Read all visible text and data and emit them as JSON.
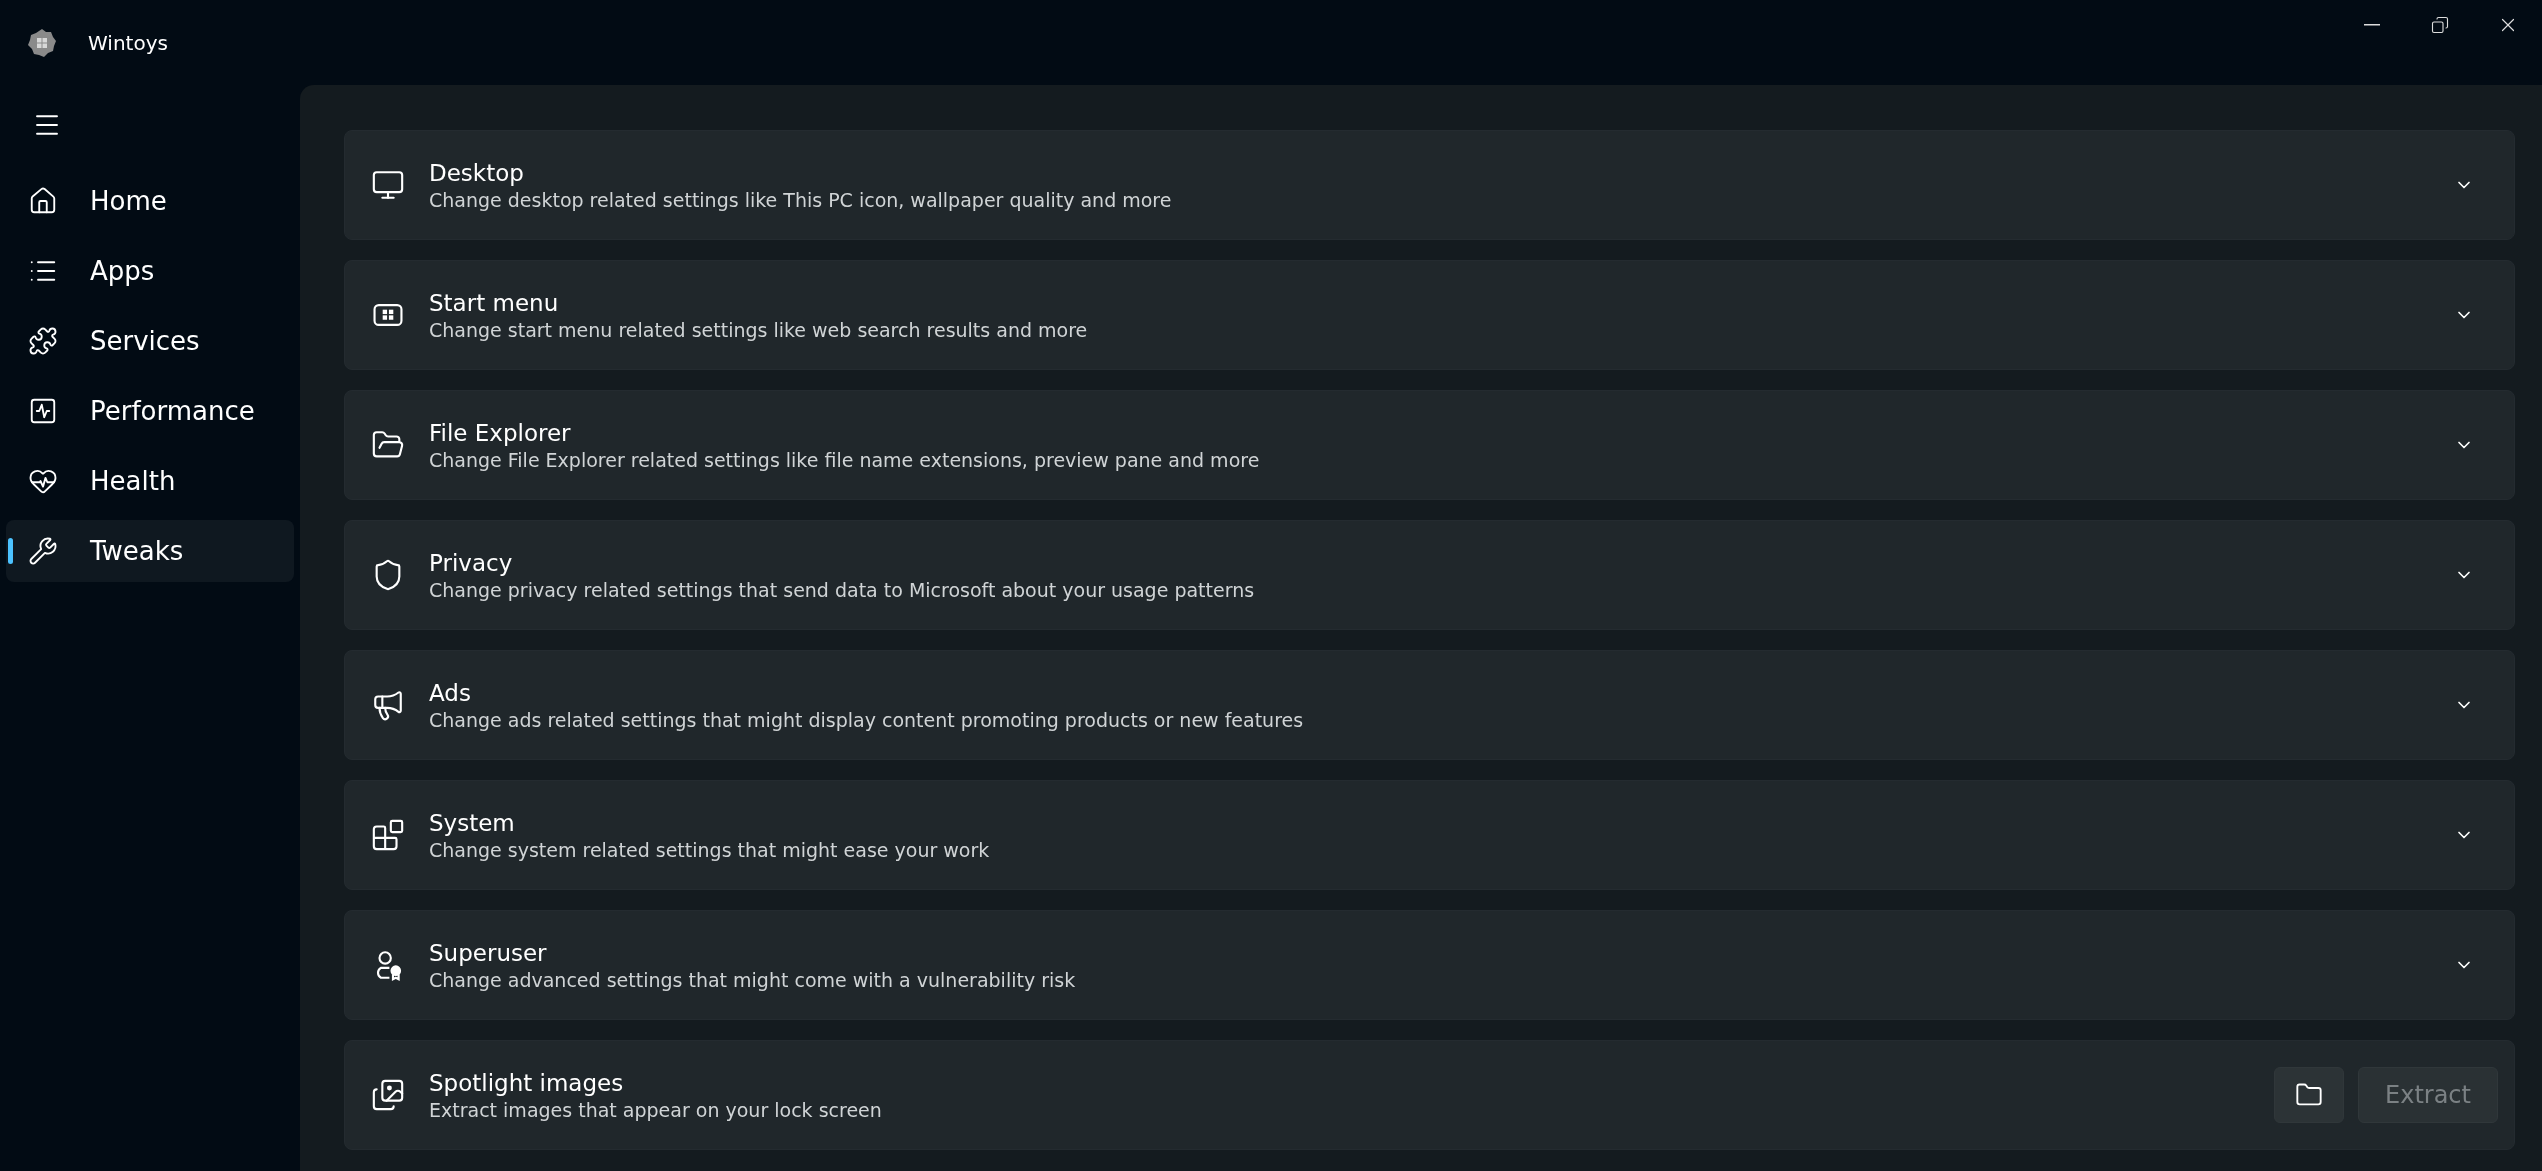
{
  "window": {
    "title": "Wintoys"
  },
  "sidebar": {
    "items": [
      {
        "label": "Home",
        "selected": false
      },
      {
        "label": "Apps",
        "selected": false
      },
      {
        "label": "Services",
        "selected": false
      },
      {
        "label": "Performance",
        "selected": false
      },
      {
        "label": "Health",
        "selected": false
      },
      {
        "label": "Tweaks",
        "selected": true
      }
    ]
  },
  "cards": [
    {
      "kind": "expander",
      "title": "Desktop",
      "description": "Change desktop related settings like This PC icon, wallpaper quality and more",
      "expanded": false
    },
    {
      "kind": "expander",
      "title": "Start menu",
      "description": "Change start menu related settings like web search results and more",
      "expanded": false
    },
    {
      "kind": "expander",
      "title": "File Explorer",
      "description": "Change File Explorer related settings like file name extensions, preview pane and more",
      "expanded": false
    },
    {
      "kind": "expander",
      "title": "Privacy",
      "description": "Change privacy related settings that send data to Microsoft about your usage patterns",
      "expanded": false
    },
    {
      "kind": "expander",
      "title": "Ads",
      "description": "Change ads related settings that might display content promoting products or new features",
      "expanded": false
    },
    {
      "kind": "expander",
      "title": "System",
      "description": "Change system related settings that might ease your work",
      "expanded": false
    },
    {
      "kind": "expander",
      "title": "Superuser",
      "description": "Change advanced settings that might come with a vulnerability risk",
      "expanded": false
    },
    {
      "kind": "action",
      "title": "Spotlight images",
      "description": "Extract images that appear on your lock screen",
      "button": {
        "label": "Extract",
        "disabled": true
      }
    }
  ]
}
